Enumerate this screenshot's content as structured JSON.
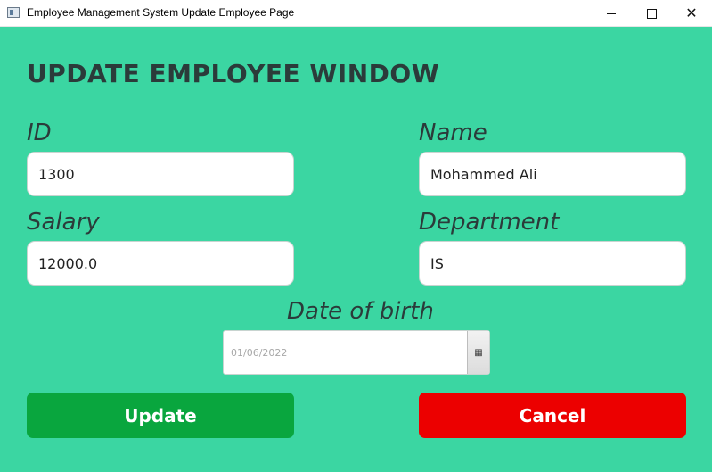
{
  "window": {
    "title": "Employee Management System Update Employee Page",
    "background_color": "#3bd6a2",
    "controls": {
      "minimize": "minimize-icon",
      "maximize": "maximize-icon",
      "close": "close-icon"
    }
  },
  "form": {
    "heading": "UPDATE EMPLOYEE WINDOW",
    "id": {
      "label": "ID",
      "value": "1300"
    },
    "name": {
      "label": "Name",
      "value": "Mohammed Ali"
    },
    "salary": {
      "label": "Salary",
      "value": "12000.0"
    },
    "department": {
      "label": "Department",
      "value": "IS"
    },
    "dob": {
      "label": "Date of birth",
      "value": "01/06/2022",
      "icon": "calendar-icon"
    }
  },
  "buttons": {
    "update": {
      "label": "Update",
      "color": "#09a63e"
    },
    "cancel": {
      "label": "Cancel",
      "color": "#ec0000"
    }
  }
}
